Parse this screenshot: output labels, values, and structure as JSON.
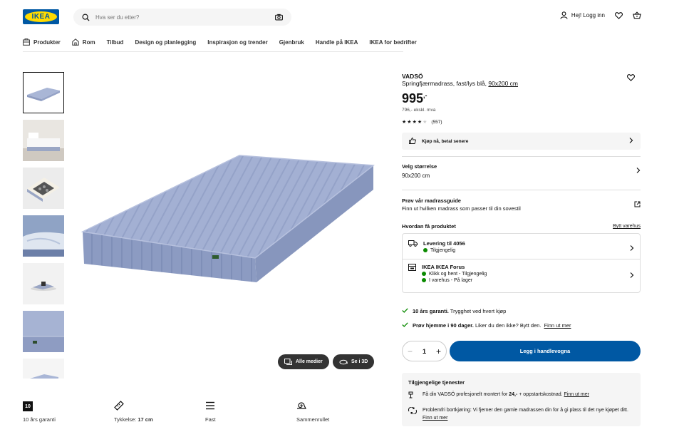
{
  "header": {
    "logo_text": "IKEA",
    "search_placeholder": "Hva ser du etter?",
    "login_label": "Hej! Logg inn"
  },
  "nav": {
    "items": [
      {
        "label": "Produkter",
        "icon": "catalog-icon"
      },
      {
        "label": "Rom",
        "icon": "home-icon"
      },
      {
        "label": "Tilbud"
      },
      {
        "label": "Design og planlegging"
      },
      {
        "label": "Inspirasjon og trender"
      },
      {
        "label": "Gjenbruk"
      },
      {
        "label": "Handle på IKEA"
      },
      {
        "label": "IKEA for bedrifter"
      }
    ]
  },
  "gallery": {
    "all_media_label": "Alle medier",
    "view_3d_label": "Se i 3D"
  },
  "features": [
    {
      "icon_text": "10",
      "label": "10 års garanti"
    },
    {
      "label_prefix": "Tykkelse: ",
      "label_value": "17 cm"
    },
    {
      "label": "Fast"
    },
    {
      "label": "Sammenrullet"
    }
  ],
  "product": {
    "brand": "VADSÖ",
    "description": "Springfjærmadrass, fast/lys blå, ",
    "size_link": "90x200 cm",
    "price": "995",
    "price_suffix": ",-",
    "price_ex_vat": "796,- ekskl. mva",
    "rating": 4,
    "review_count": "(557)",
    "klarna_label": "Kjøp nå, betal senere"
  },
  "size": {
    "title": "Velg størrelse",
    "value": "90x200 cm"
  },
  "guide": {
    "title": "Prøv vår madrassguide",
    "subtitle": "Finn ut hvilken madrass som passer til din sovestil"
  },
  "delivery": {
    "title": "Hvordan få produktet",
    "change_store": "Bytt varehus",
    "home": {
      "title": "Levering til 4056",
      "status": "Tilgjengelig"
    },
    "store": {
      "title": "IKEA IKEA Forus",
      "status1": "Klikk og hent - Tilgjengelig",
      "status2": "I varehus - På lager"
    }
  },
  "usps": {
    "warranty_bold": "10 års garanti.",
    "warranty_text": " Trygghet ved hvert kjøp",
    "trial_bold": "Prøv hjemme i 90 dager.",
    "trial_text": " Liker du den ikke? Bytt den.",
    "trial_link": "Finn ut mer"
  },
  "cart": {
    "quantity": "1",
    "add_label": "Legg i handlevogna"
  },
  "services": {
    "title": "Tilgjengelige tjenester",
    "assembly_text": "Få din VADSÖ profesjonelt montert for ",
    "assembly_bold": "24,-",
    "assembly_text2": " + oppstartskostnad. ",
    "assembly_link": "Finn ut mer",
    "removal_text": "Problemfri bortkjøring: Vi fjerner den gamle madrassen din for å gi plass til det nye kjøpet ditt. ",
    "removal_link": "Finn ut mer"
  },
  "colors": {
    "ikea_blue": "#0058a3",
    "ikea_yellow": "#ffdb00",
    "stock_green": "#0a8a00",
    "mattress_blue": "#9ba9cf"
  }
}
